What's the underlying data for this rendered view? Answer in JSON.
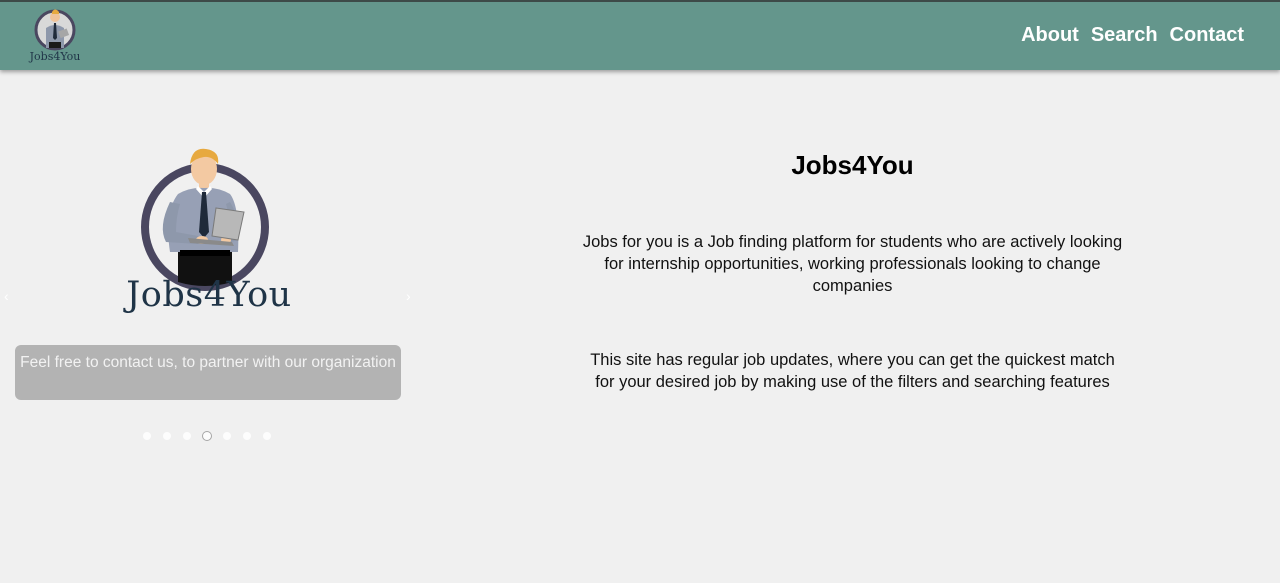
{
  "header": {
    "logo_text": "Jobs4You",
    "nav": [
      "About",
      "Search",
      "Contact"
    ]
  },
  "carousel": {
    "brand_text": "Jobs4You",
    "caption": "Feel free to contact us, to partner with our organization",
    "slide_count": 7,
    "active_index": 3
  },
  "main": {
    "title": "Jobs4You",
    "paragraph1": "Jobs for you is a Job finding platform for students who are actively looking for internship opportunities, working professionals looking to change companies",
    "paragraph2": "This site has regular job updates, where you can get the quickest match for your desired job by making use of the filters and searching features"
  },
  "colors": {
    "header_bg": "#64968c",
    "page_bg": "#f0f0f0",
    "logo_ring": "#4a4760",
    "brand_text": "#1f3447"
  },
  "icons": {
    "logo": "man-with-laptop-logo",
    "prev": "chevron-left-icon",
    "next": "chevron-right-icon"
  }
}
